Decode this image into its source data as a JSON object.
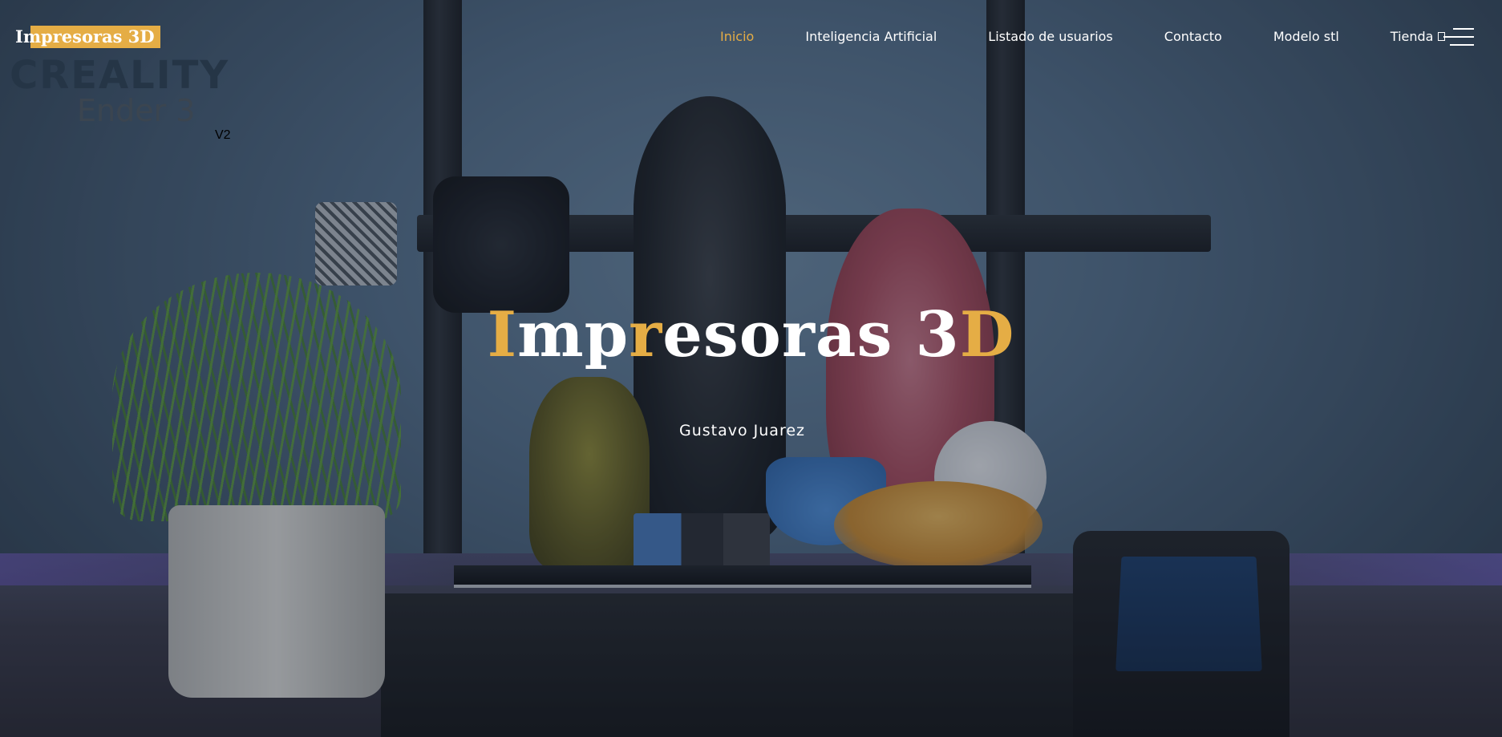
{
  "header": {
    "site_title": "Impresoras 3D",
    "nav": [
      {
        "label": "Inicio",
        "active": true
      },
      {
        "label": "Inteligencia Artificial",
        "active": false
      },
      {
        "label": "Listado de usuarios",
        "active": false
      },
      {
        "label": "Contacto",
        "active": false
      },
      {
        "label": "Modelo stl",
        "active": false
      },
      {
        "label": "Tienda",
        "active": false
      }
    ],
    "cart_icon": "cart-icon",
    "menu_icon": "hamburger-menu-icon"
  },
  "brand_logo": {
    "line1": "CREALITY",
    "line2": "Ender 3",
    "badge": "V2"
  },
  "hero": {
    "title_parts": [
      {
        "text": "I",
        "accent": true
      },
      {
        "text": "mp",
        "accent": false
      },
      {
        "text": "r",
        "accent": true
      },
      {
        "text": "esoras 3",
        "accent": false
      },
      {
        "text": "D",
        "accent": true
      }
    ],
    "subtitle": "Gustavo Juarez"
  },
  "colors": {
    "accent": "#e5ad45",
    "text": "#ffffff",
    "logo_dark": "#253546",
    "logo_red": "#9b1f2b"
  }
}
